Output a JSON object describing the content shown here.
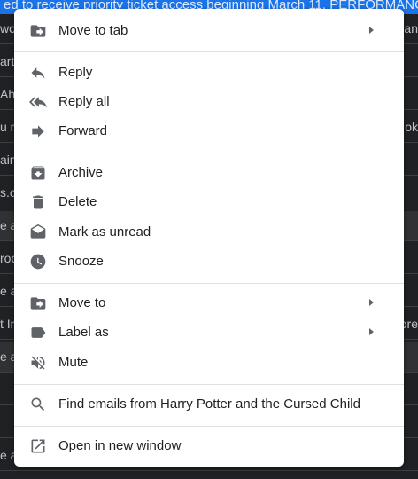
{
  "background": {
    "top_banner": "ed to receive priority ticket access beginning March 11. PERFORMANCE",
    "rows": [
      {
        "left": "wo",
        "right": "ean"
      },
      {
        "left": "art",
        "right": ""
      },
      {
        "left": "Ah",
        "right": ""
      },
      {
        "left": "u n",
        "right": "ok"
      },
      {
        "left": "ain",
        "right": ""
      },
      {
        "left": "s.c",
        "right": ""
      },
      {
        "left": "e a",
        "right": ""
      },
      {
        "left": "roc",
        "right": ""
      },
      {
        "left": "e a",
        "right": ""
      },
      {
        "left": "t In",
        "right": "ore"
      },
      {
        "left": "e a",
        "right": ""
      },
      {
        "left": "",
        "right": ""
      },
      {
        "left": "",
        "right": ""
      },
      {
        "left": "e a",
        "right": ""
      }
    ]
  },
  "menu": {
    "move_to_tab": {
      "label": "Move to tab",
      "icon": "move-to-tab-icon"
    },
    "reply": {
      "label": "Reply",
      "icon": "reply-icon"
    },
    "reply_all": {
      "label": "Reply all",
      "icon": "reply-all-icon"
    },
    "forward": {
      "label": "Forward",
      "icon": "forward-icon"
    },
    "archive": {
      "label": "Archive",
      "icon": "archive-icon"
    },
    "delete": {
      "label": "Delete",
      "icon": "trash-icon"
    },
    "mark_unread": {
      "label": "Mark as unread",
      "icon": "mark-unread-icon"
    },
    "snooze": {
      "label": "Snooze",
      "icon": "clock-icon"
    },
    "move_to": {
      "label": "Move to",
      "icon": "move-to-icon"
    },
    "label_as": {
      "label": "Label as",
      "icon": "label-icon"
    },
    "mute": {
      "label": "Mute",
      "icon": "mute-icon"
    },
    "find_emails": {
      "label": "Find emails from Harry Potter and the Cursed Child",
      "icon": "search-icon"
    },
    "open_new_window": {
      "label": "Open in new window",
      "icon": "open-new-window-icon"
    }
  },
  "colors": {
    "menu_bg": "#ffffff",
    "icon": "#5f6368",
    "text": "#202124",
    "banner": "#1a73e8",
    "page_bg": "#202124"
  }
}
